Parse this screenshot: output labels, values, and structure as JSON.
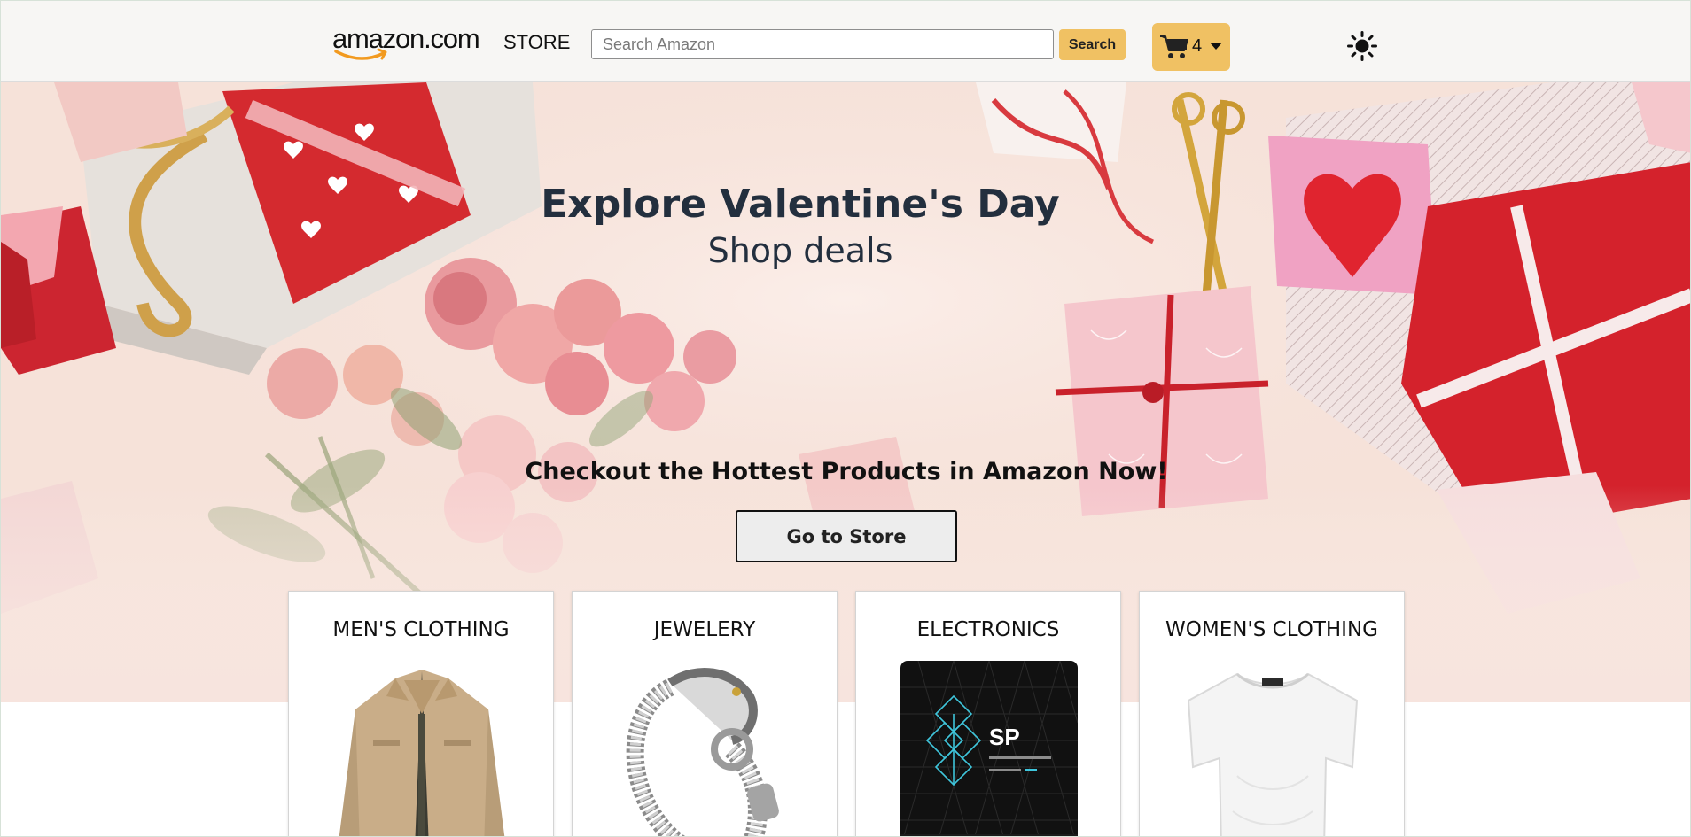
{
  "header": {
    "logo_text": "amazon.com",
    "store_label": "STORE",
    "search_placeholder": "Search Amazon",
    "search_button_label": "Search",
    "cart_count": "4",
    "theme_icon": "sun-icon"
  },
  "hero": {
    "title": "Explore Valentine's Day",
    "subtitle": "Shop deals",
    "tagline": "Checkout the Hottest Products in Amazon Now!",
    "cta_label": "Go to Store"
  },
  "categories": [
    {
      "label": "MEN'S CLOTHING",
      "image": "men-jacket-image"
    },
    {
      "label": "JEWELERY",
      "image": "dragon-bracelet-image"
    },
    {
      "label": "ELECTRONICS",
      "image": "ssd-drive-image"
    },
    {
      "label": "WOMEN'S CLOTHING",
      "image": "women-tshirt-image"
    }
  ],
  "ssd_brand": "SP",
  "colors": {
    "accent": "#f0c163",
    "header_bg": "#f7f6f4",
    "hero_text": "#232f3e",
    "logo_smile": "#f29a1f"
  }
}
